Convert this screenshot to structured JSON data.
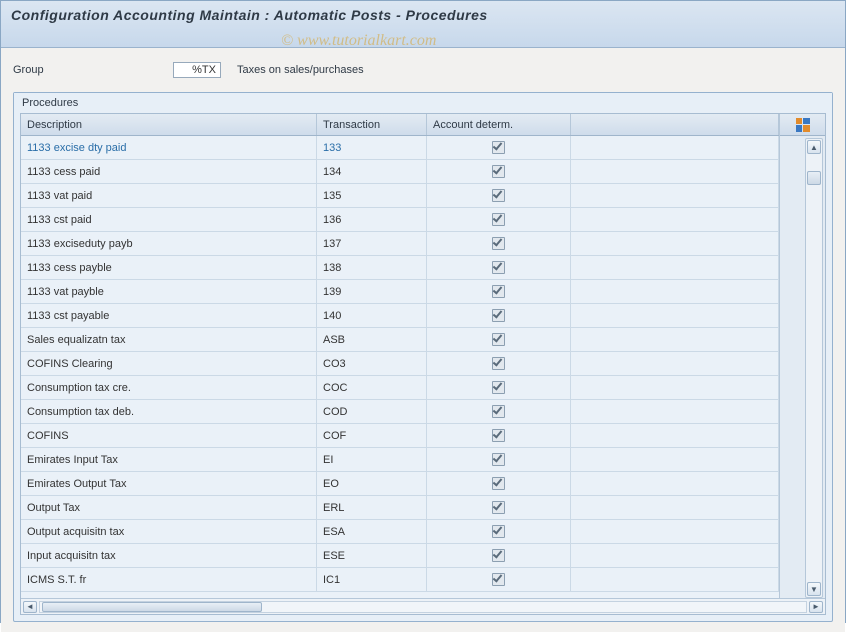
{
  "title": "Configuration Accounting Maintain : Automatic Posts - Procedures",
  "watermark": "© www.tutorialkart.com",
  "group": {
    "label": "Group",
    "value": "%TX",
    "description": "Taxes on sales/purchases"
  },
  "panel": {
    "title": "Procedures",
    "columns": {
      "description": "Description",
      "transaction": "Transaction",
      "account_determ": "Account determ."
    },
    "rows": [
      {
        "description": "1133 excise dty paid",
        "transaction": "133",
        "account_determ": true,
        "selected": true
      },
      {
        "description": "1133 cess paid",
        "transaction": "134",
        "account_determ": true
      },
      {
        "description": "1133 vat paid",
        "transaction": "135",
        "account_determ": true
      },
      {
        "description": "1133 cst paid",
        "transaction": "136",
        "account_determ": true
      },
      {
        "description": "1133 exciseduty payb",
        "transaction": "137",
        "account_determ": true
      },
      {
        "description": "1133 cess payble",
        "transaction": "138",
        "account_determ": true
      },
      {
        "description": "1133 vat payble",
        "transaction": "139",
        "account_determ": true
      },
      {
        "description": "1133 cst payable",
        "transaction": "140",
        "account_determ": true
      },
      {
        "description": "Sales equalizatn tax",
        "transaction": "ASB",
        "account_determ": true
      },
      {
        "description": "COFINS Clearing",
        "transaction": "CO3",
        "account_determ": true
      },
      {
        "description": "Consumption tax cre.",
        "transaction": "COC",
        "account_determ": true
      },
      {
        "description": "Consumption tax deb.",
        "transaction": "COD",
        "account_determ": true
      },
      {
        "description": "COFINS",
        "transaction": "COF",
        "account_determ": true
      },
      {
        "description": "Emirates Input Tax",
        "transaction": "EI",
        "account_determ": true
      },
      {
        "description": "Emirates Output Tax",
        "transaction": "EO",
        "account_determ": true
      },
      {
        "description": "Output Tax",
        "transaction": "ERL",
        "account_determ": true
      },
      {
        "description": "Output acquisitn tax",
        "transaction": "ESA",
        "account_determ": true
      },
      {
        "description": "Input acquisitn tax",
        "transaction": "ESE",
        "account_determ": true
      },
      {
        "description": "ICMS S.T. fr",
        "transaction": "IC1",
        "account_determ": true
      }
    ]
  }
}
